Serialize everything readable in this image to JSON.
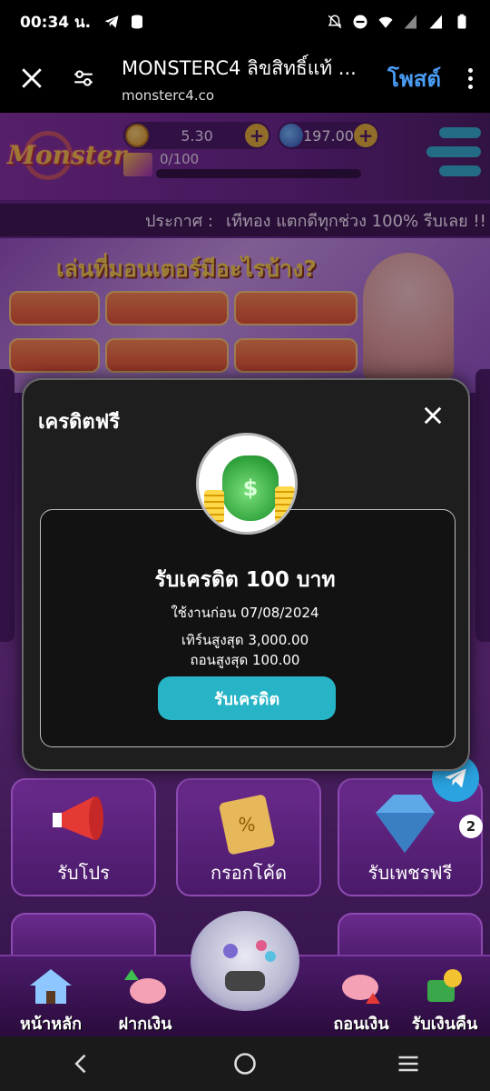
{
  "status_bar": {
    "time": "00:34 น.",
    "left_icons": [
      "telegram-icon",
      "storage-icon"
    ],
    "right_icons": [
      "mute-icon",
      "dnd-icon",
      "wifi-icon",
      "signal-icon",
      "signal-icon",
      "battery-icon"
    ]
  },
  "browser": {
    "title": "MONSTERC4 ลิขสิทธิ์แท้ ...",
    "url": "monsterc4.co",
    "post_label": "โพสต์"
  },
  "site": {
    "logo_text": "Monster",
    "wallet": {
      "credit": "5.30",
      "diamonds": "197.00"
    },
    "level_progress": "0/100",
    "announcement": {
      "label": "ประกาศ :",
      "message": "เทีทอง แตกดีทุกช่วง 100% รีบเลย !!"
    },
    "banner": {
      "headline": "เล่นที่มอนเตอร์มีอะไรบ้าง?"
    },
    "tiles": [
      {
        "label": "รับโปร"
      },
      {
        "label": "กรอกโค้ด"
      },
      {
        "label": "รับเพชรฟรี"
      }
    ],
    "bottom_nav": [
      {
        "label": "หน้าหลัก"
      },
      {
        "label": "ฝากเงิน"
      },
      {
        "label": "ถอนเงิน"
      },
      {
        "label": "รับเงินคืน"
      }
    ],
    "notification_count": "2"
  },
  "modal": {
    "title": "เครดิตฟรี",
    "reward_title": "รับเครดิต 100 บาท",
    "expiry": "ใช้งานก่อน 07/08/2024",
    "max_turnover": "เทิร์นสูงสุด 3,000.00",
    "max_withdraw": "ถอนสูงสุด 100.00",
    "claim_label": "รับเครดิต"
  },
  "colors": {
    "accent": "#26b4c6",
    "modal_bg": "#1e1e1e",
    "site_purple": "#5a1e7e",
    "link_blue": "#4a9cf5"
  }
}
